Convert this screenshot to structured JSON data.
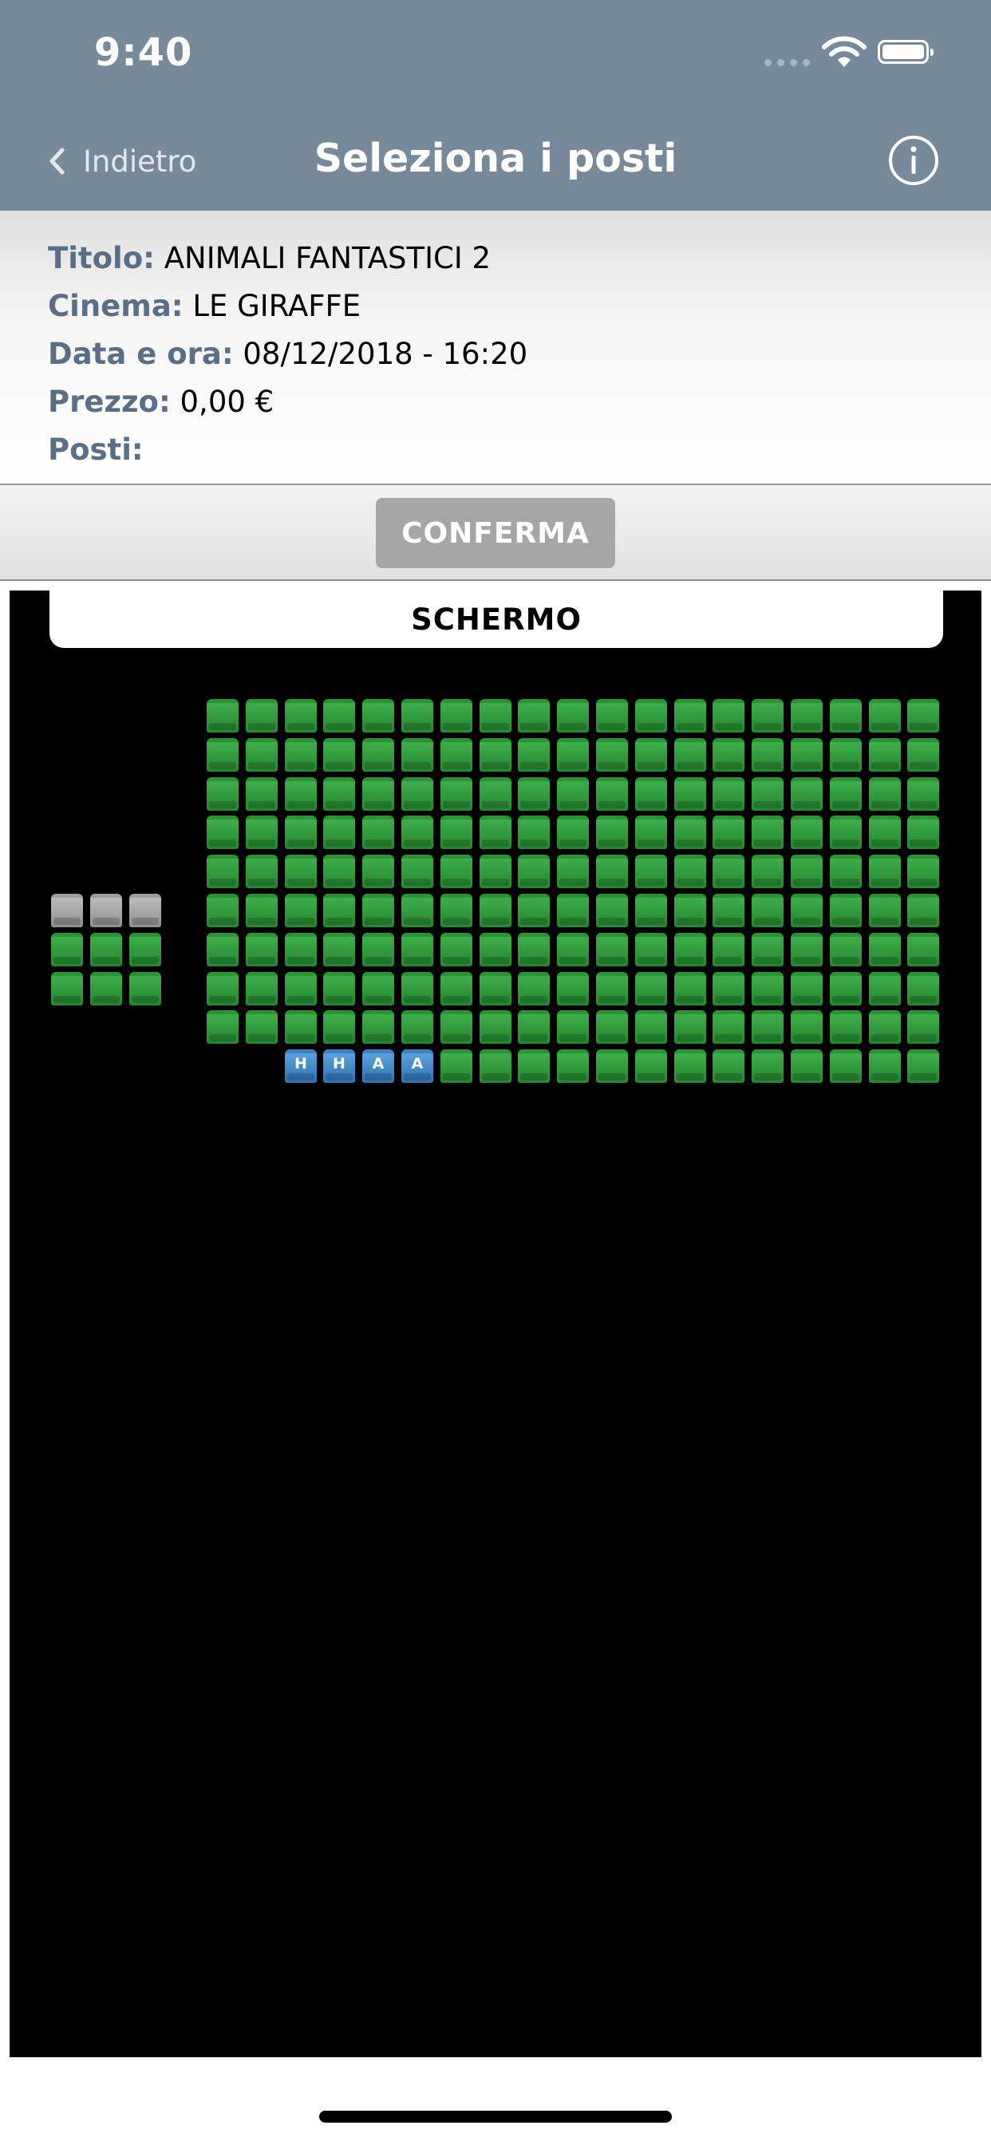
{
  "status_bar": {
    "time": "9:40",
    "icons": [
      "signal-icon",
      "wifi-icon",
      "battery-icon"
    ]
  },
  "nav": {
    "back_label": "Indietro",
    "title": "Seleziona i posti",
    "info_icon": "info-icon"
  },
  "info": {
    "title_label": "Titolo:",
    "title_value": "ANIMALI FANTASTICI 2",
    "cinema_label": "Cinema:",
    "cinema_value": "LE GIRAFFE",
    "datetime_label": "Data e ora:",
    "datetime_value": "08/12/2018 - 16:20",
    "price_label": "Prezzo:",
    "price_value": "0,00 €",
    "seats_label": "Posti:",
    "seats_value": ""
  },
  "confirm_label": "CONFERMA",
  "screen_label": "SCHERMO",
  "colors": {
    "header": "#778a9b",
    "seat_free": "#2e9b3a",
    "seat_occupied": "#a3a3a3",
    "seat_special": "#3f86c8",
    "confirm_disabled": "#a6a6a6"
  },
  "seat_map": {
    "left_block": {
      "rows": [
        [
          "occupied",
          "occupied",
          "occupied"
        ],
        [
          "free",
          "free",
          "free"
        ],
        [
          "free",
          "free",
          "free"
        ]
      ]
    },
    "main_block": {
      "columns": 19,
      "full_rows": 9,
      "last_row": [
        {
          "type": "special",
          "label": "H"
        },
        {
          "type": "special",
          "label": "H"
        },
        {
          "type": "special",
          "label": "A"
        },
        {
          "type": "special",
          "label": "A"
        },
        {
          "type": "free"
        },
        {
          "type": "free"
        },
        {
          "type": "free"
        },
        {
          "type": "free"
        },
        {
          "type": "free"
        },
        {
          "type": "free"
        },
        {
          "type": "free"
        },
        {
          "type": "free"
        },
        {
          "type": "free"
        },
        {
          "type": "free"
        },
        {
          "type": "free"
        },
        {
          "type": "free"
        },
        {
          "type": "free"
        }
      ]
    }
  }
}
